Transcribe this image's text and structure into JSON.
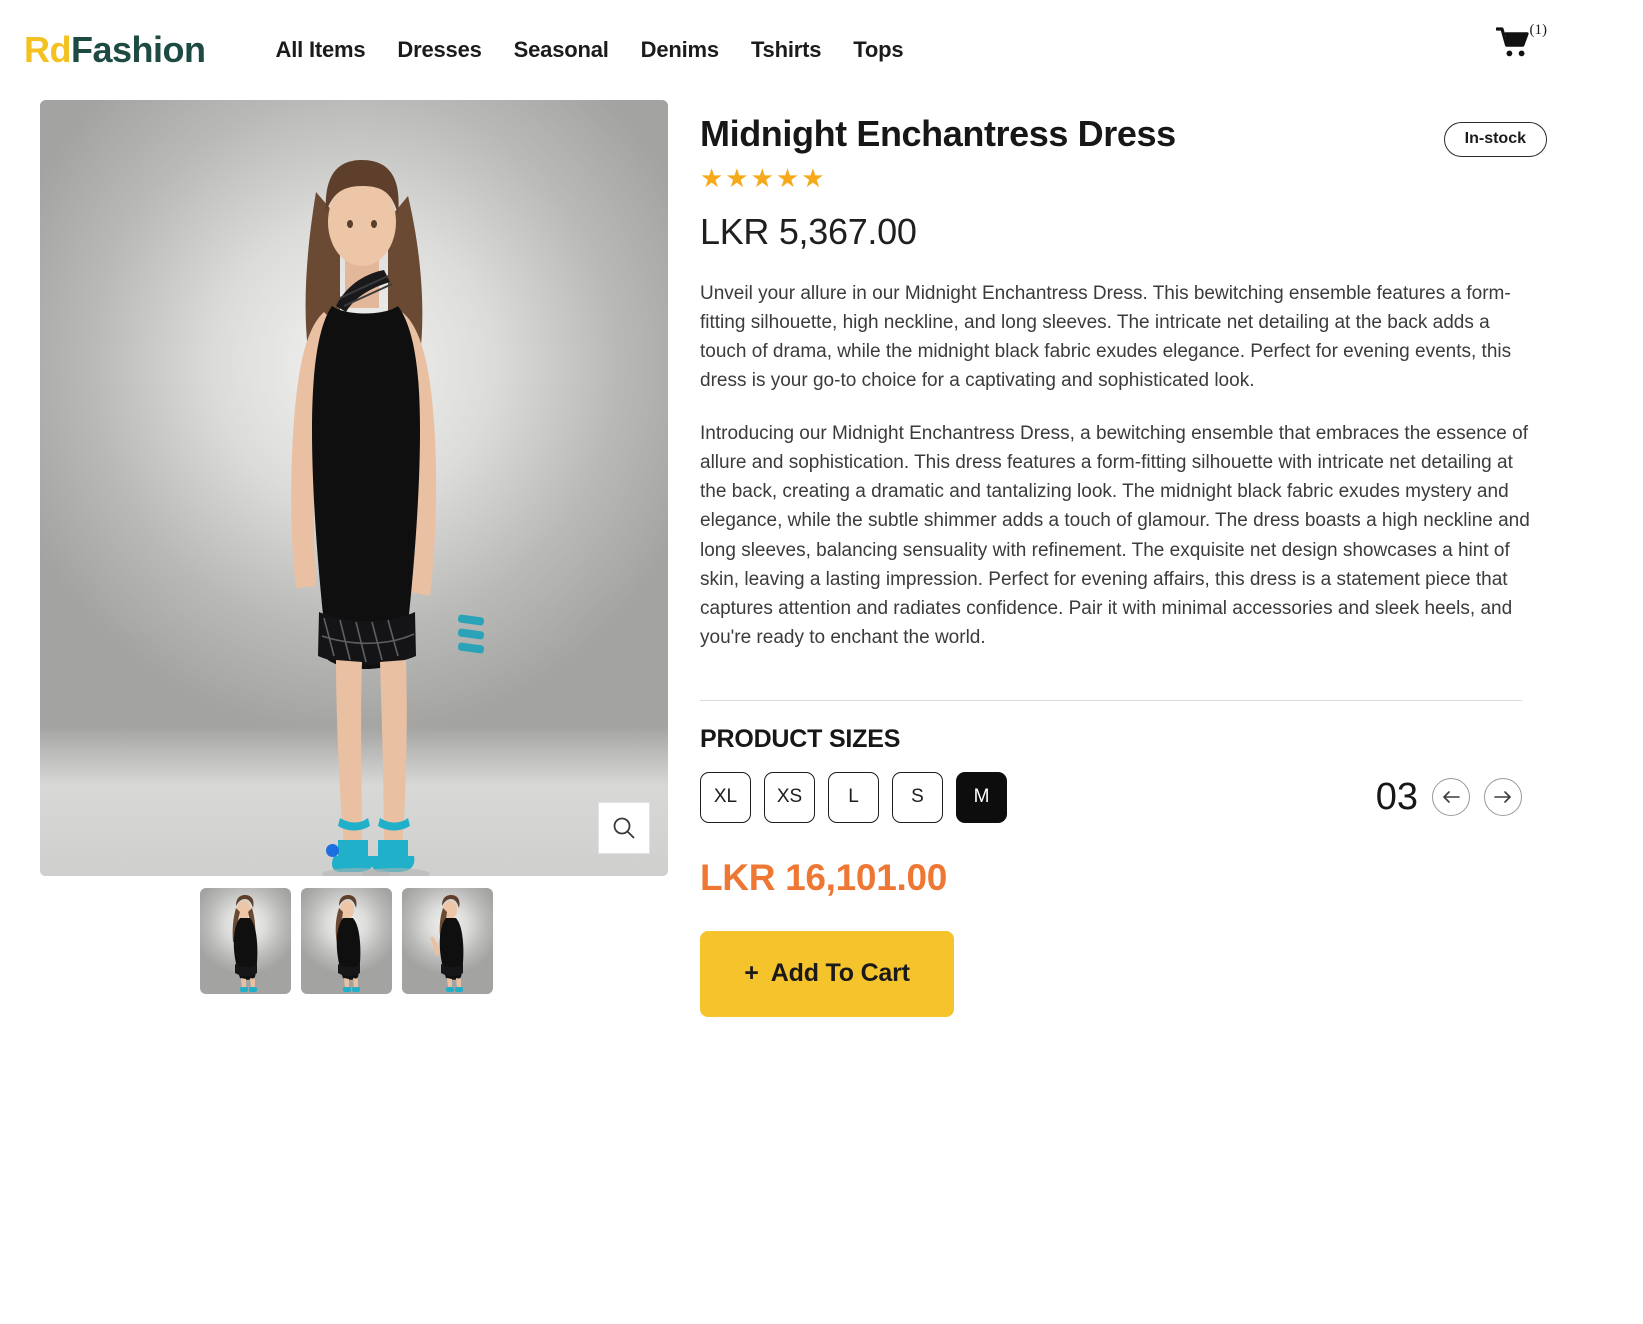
{
  "header": {
    "brand_prefix": "Rd",
    "brand_suffix": "Fashion",
    "nav": [
      {
        "label": "All Items"
      },
      {
        "label": "Dresses"
      },
      {
        "label": "Seasonal"
      },
      {
        "label": "Denims"
      },
      {
        "label": "Tshirts"
      },
      {
        "label": "Tops"
      }
    ],
    "cart_icon": "shopping-cart-icon",
    "cart_count": "(1)"
  },
  "gallery": {
    "zoom_icon": "magnifier-icon",
    "thumbnails": [
      {
        "alt": "Model front view wearing black dress",
        "active": true
      },
      {
        "alt": "Model back view wearing black dress",
        "active": false
      },
      {
        "alt": "Model side view wearing black dress",
        "active": false
      }
    ]
  },
  "product": {
    "title": "Midnight Enchantress Dress",
    "stock_status": "In-stock",
    "rating_stars": "★★★★★",
    "rating_value": 5,
    "price": "LKR 5,367.00",
    "description_1": "Unveil your allure in our Midnight Enchantress Dress. This bewitching ensemble features a form-fitting silhouette, high neckline, and long sleeves. The intricate net detailing at the back adds a touch of drama, while the midnight black fabric exudes elegance. Perfect for evening events, this dress is your go-to choice for a captivating and sophisticated look.",
    "description_2": "Introducing our Midnight Enchantress Dress, a bewitching ensemble that embraces the essence of allure and sophistication. This dress features a form-fitting silhouette with intricate net detailing at the back, creating a dramatic and tantalizing look. The midnight black fabric exudes mystery and elegance, while the subtle shimmer adds a touch of glamour. The dress boasts a high neckline and long sleeves, balancing sensuality with refinement. The exquisite net design showcases a hint of skin, leaving a lasting impression. Perfect for evening affairs, this dress is a statement piece that captures attention and radiates confidence. Pair it with minimal accessories and sleek heels, and you're ready to enchant the world."
  },
  "sizes": {
    "heading": "PRODUCT SIZES",
    "options": [
      {
        "label": "XL",
        "selected": false
      },
      {
        "label": "XS",
        "selected": false
      },
      {
        "label": "L",
        "selected": false
      },
      {
        "label": "S",
        "selected": false
      },
      {
        "label": "M",
        "selected": true
      }
    ]
  },
  "quantity": {
    "value": "03",
    "decrease_icon": "arrow-left-icon",
    "increase_icon": "arrow-right-icon"
  },
  "checkout": {
    "total_price": "LKR 16,101.00",
    "add_to_cart_plus": "+",
    "add_to_cart_label": "Add To Cart"
  },
  "colors": {
    "brand_yellow": "#f3c222",
    "brand_green": "#1d4a42",
    "accent_orange": "#ee7733",
    "cta_yellow": "#f5c32c",
    "star_gold": "#f6a91b",
    "dot_blue": "#1d6fe0",
    "thumb_active_underline": "#f0b323"
  }
}
